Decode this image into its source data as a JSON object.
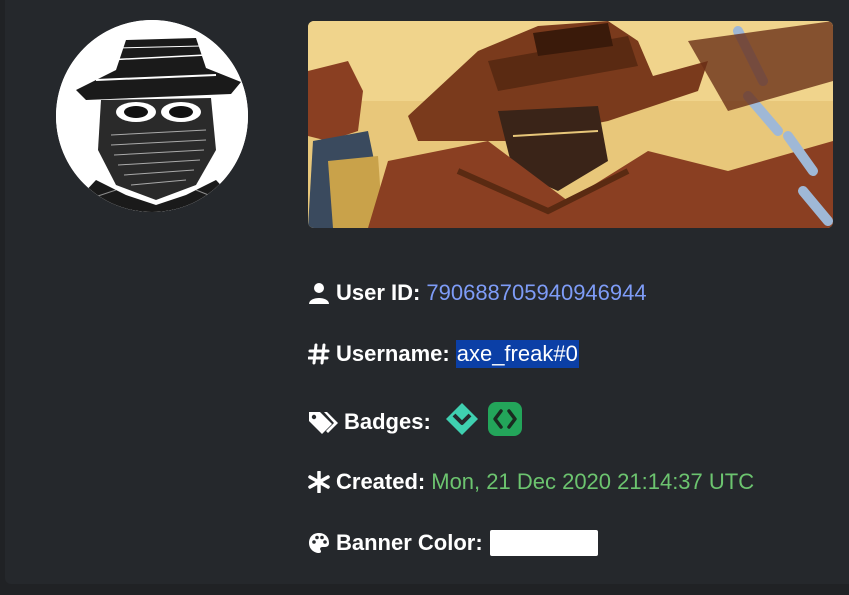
{
  "profile": {
    "avatar_icon": "masked-cowboy-avatar",
    "banner_icon": "cowboy-banner-art",
    "user_id": {
      "label": "User ID",
      "value": "790688705940946944",
      "icon": "user-icon"
    },
    "username": {
      "label": "Username",
      "value": "axe_freak#0",
      "icon": "hashtag-icon"
    },
    "badges": {
      "label": "Badges",
      "icon": "tags-icon",
      "items": [
        "hypesquad-balance-badge",
        "active-developer-badge"
      ]
    },
    "created": {
      "label": "Created",
      "value": "Mon, 21 Dec 2020 21:14:37 UTC",
      "icon": "asterisk-icon"
    },
    "banner_color": {
      "label": "Banner Color",
      "value": "#ffffff",
      "icon": "palette-icon"
    }
  },
  "colors": {
    "background": "#202225",
    "card": "#25282c",
    "link": "#7e9cf7",
    "date": "#6cc46f",
    "selection": "#0b3fa6",
    "badge_hypesquad": "#3fd0b0",
    "badge_developer": "#23a55a"
  }
}
